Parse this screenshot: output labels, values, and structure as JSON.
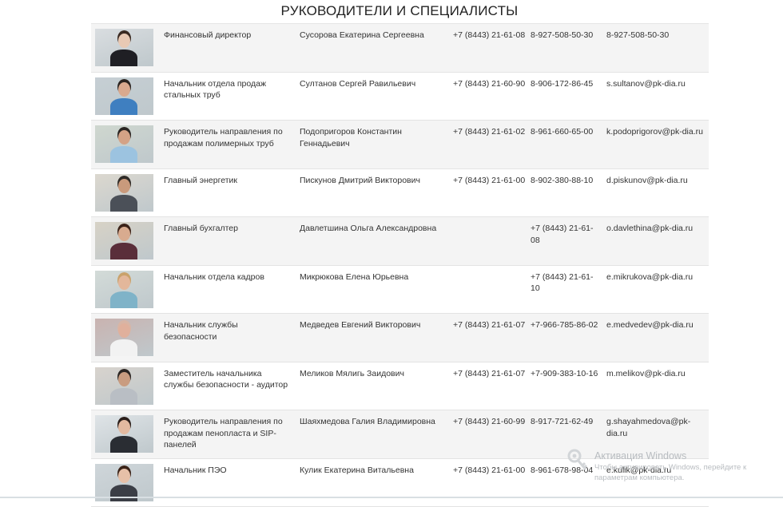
{
  "page": {
    "title": "РУКОВОДИТЕЛИ И СПЕЦИАЛИСТЫ"
  },
  "rows": [
    {
      "position": "Финансовый директор",
      "name": "Сусорова Екатерина Сергеевна",
      "phone": "+7 (8443) 21-61-08",
      "mobile": "8-927-508-50-30",
      "email": "8-927-508-50-30",
      "photo": {
        "bg": "#d9dde0",
        "skin": "#e8c9b4",
        "shirt": "#1f1f24",
        "hair": "#3a2a22"
      }
    },
    {
      "position": "Начальник отдела продаж стальных труб",
      "name": "Султанов Сергей Равильевич",
      "phone": "+7 (8443) 21-60-90",
      "mobile": "8-906-172-86-45",
      "email": "s.sultanov@pk-dia.ru",
      "photo": {
        "bg": "#c6cfd4",
        "skin": "#d9a98e",
        "shirt": "#3f7fc0",
        "hair": "#2b2420"
      }
    },
    {
      "position": "Руководитель направления по продажам полимерных труб",
      "name": "Подопригоров Константин Геннадьевич",
      "phone": "+7 (8443) 21-61-02",
      "mobile": "8-961-660-65-00",
      "email": "k.podoprigorov@pk-dia.ru",
      "photo": {
        "bg": "#cfd7cf",
        "skin": "#d4a286",
        "shirt": "#9cc3e0",
        "hair": "#2a2522"
      }
    },
    {
      "position": "Главный энергетик",
      "name": "Пискунов Дмитрий  Викторович",
      "phone": "+7 (8443) 21-61-00",
      "mobile": "8-902-380-88-10",
      "email": "d.piskunov@pk-dia.ru",
      "photo": {
        "bg": "#dcd8cf",
        "skin": "#c99a7c",
        "shirt": "#4b5058",
        "hair": "#2e2a26"
      }
    },
    {
      "position": "Главный бухгалтер",
      "name": "Давлетшина Ольга Александровна",
      "phone": "",
      "mobile": "+7 (8443) 21-61-08",
      "email": "o.davlethina@pk-dia.ru",
      "photo": {
        "bg": "#d7d2c6",
        "skin": "#d8ab8f",
        "shirt": "#5a2e3a",
        "hair": "#3b2218"
      }
    },
    {
      "position": "Начальник отдела кадров",
      "name": "Микрюкова Елена Юрьевна",
      "phone": "",
      "mobile": "+7 (8443) 21-61-10",
      "email": "e.mikrukova@pk-dia.ru",
      "photo": {
        "bg": "#d3dbd8",
        "skin": "#e3b79b",
        "shirt": "#7fb3c8",
        "hair": "#c9a26b"
      }
    },
    {
      "position": "Начальник службы безопасности",
      "name": "Медведев Евгений Викторович",
      "phone": "+7 (8443) 21-61-07",
      "mobile": "+7-966-785-86-02",
      "email": "e.medvedev@pk-dia.ru",
      "photo": {
        "bg": "#c9b3b0",
        "skin": "#e0b09c",
        "shirt": "#f2f2f2",
        "hair": "#d8b5a5"
      }
    },
    {
      "position": "Заместитель начальника службы безопасности - аудитор",
      "name": "Меликов Мялигь Заидович",
      "phone": "+7 (8443) 21-61-07",
      "mobile": "+7-909-383-10-16",
      "email": "m.melikov@pk-dia.ru",
      "photo": {
        "bg": "#d8d3cd",
        "skin": "#c99c80",
        "shirt": "#b9bec4",
        "hair": "#2c2623"
      }
    },
    {
      "position": "Руководитель направления по продажам пенопласта и SIP-панелей",
      "name": "Шаяхмедова Галия Владимировна",
      "phone": "+7 (8443) 21-60-99",
      "mobile": "8-917-721-62-49",
      "email": "g.shayahmedova@pk-dia.ru",
      "photo": {
        "bg": "#dfe4e7",
        "skin": "#e2b9a0",
        "shirt": "#2a2d33",
        "hair": "#2a1e1a"
      }
    },
    {
      "position": "Начальник ПЭО",
      "name": "Кулик Екатерина Витальевна",
      "phone": "+7 (8443) 21-61-00",
      "mobile": "8-961-678-98-04",
      "email": "e.kulik@pk-dia.ru",
      "photo": {
        "bg": "#cfd6da",
        "skin": "#e6c0a8",
        "shirt": "#3b3e46",
        "hair": "#3a2318"
      }
    }
  ],
  "watermark": {
    "title": "Активация Windows",
    "text": "Чтобы активировать Windows, перейдите к параметрам компьютера."
  },
  "colors": {
    "row_alt": "#f4f4f4",
    "text": "#333333",
    "watermark": "#b8bcc0"
  }
}
